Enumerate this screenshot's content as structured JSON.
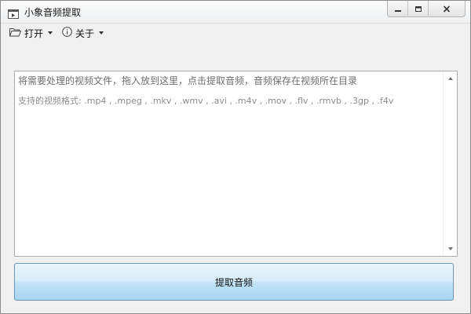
{
  "window": {
    "title": "小象音频提取"
  },
  "titlebar_controls": {
    "minimize_icon": "minimize-icon",
    "maximize_icon": "maximize-icon",
    "close_icon": "close-icon"
  },
  "menu": {
    "open_label": "打开",
    "about_label": "关于",
    "open_icon": "folder-icon",
    "about_icon": "info-icon"
  },
  "drop_area": {
    "hint": "将需要处理的视频文件，拖入放到这里，点击提取音频，音频保存在视频所在目录",
    "formats": "支持的视频格式: .mp4 , .mpeg , .mkv , .wmv , .avi , .m4v , .mov , .flv , .rmvb , .3gp , .f4v"
  },
  "actions": {
    "extract_label": "提取音频"
  },
  "colors": {
    "button_top": "#eaf5fc",
    "button_bottom": "#a9d6f0",
    "button_border": "#6d93b8",
    "hint_text": "#6d6d6d"
  }
}
